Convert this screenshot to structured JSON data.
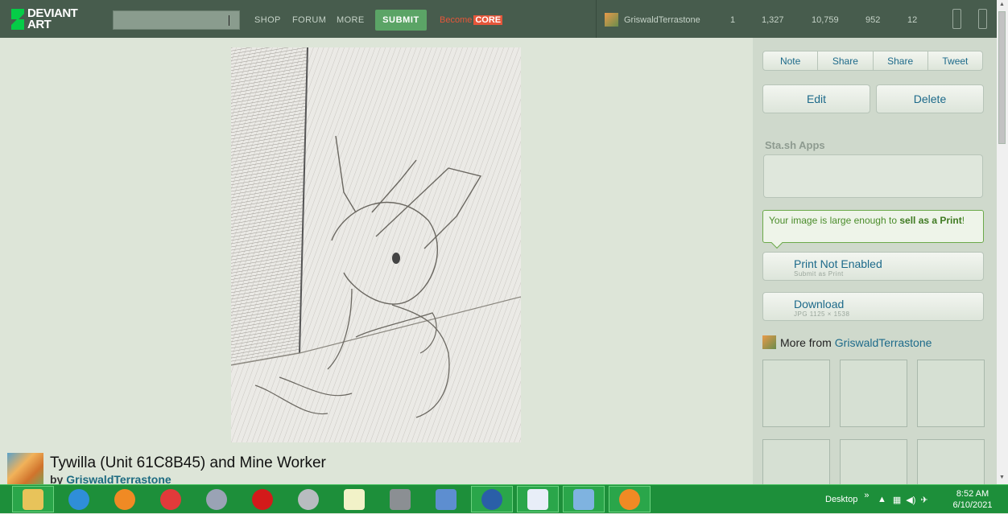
{
  "header": {
    "logo_line1": "DEVIANT",
    "logo_line2": "ART",
    "nav": [
      "SHOP",
      "FORUM",
      "MORE"
    ],
    "submit_label": "SUBMIT",
    "become_label": "Become",
    "core_label": "CORE",
    "username": "GriswaldTerrastone",
    "stats": [
      "1",
      "1,327",
      "10,759",
      "952",
      "12"
    ]
  },
  "deviation": {
    "title": "Tywilla (Unit 61C8B45) and Mine Worker",
    "by_label": "by",
    "author": "GriswaldTerrastone"
  },
  "sidebar": {
    "actions": [
      "Note",
      "Share",
      "Share",
      "Tweet"
    ],
    "edit_label": "Edit",
    "delete_label": "Delete",
    "stash_apps_label": "Sta.sh Apps",
    "notice_text_1": "Your image is large enough to ",
    "notice_bold_1": "sell as a Print",
    "notice_text_2": "!",
    "print_label": "Print Not Enabled",
    "print_sub": "Submit as Print",
    "download_label": "Download",
    "download_sub": "JPG 1125 × 1538",
    "more_from_label": "More from",
    "more_from_user": "GriswaldTerrastone"
  },
  "taskbar": {
    "items": [
      "file-explorer-icon",
      "internet-explorer-icon",
      "firefox-icon",
      "vivaldi-icon",
      "app-icon",
      "opera-icon",
      "audio-icon",
      "notepad-icon",
      "grid-app-icon",
      "keyboard-app-icon",
      "media-icon",
      "document-icon",
      "photos-icon",
      "firefox-active-icon"
    ],
    "desktop_label": "Desktop",
    "chevron": "»",
    "time": "8:52 AM",
    "date": "6/10/2021"
  },
  "colors": {
    "header": "#475c4d",
    "page_bg": "#dde5d8",
    "sidebar_bg": "#cfd9cc",
    "submit": "#5ba466",
    "core": "#e5563a",
    "link": "#1d6a8a",
    "taskbar": "#1d8f3a"
  }
}
